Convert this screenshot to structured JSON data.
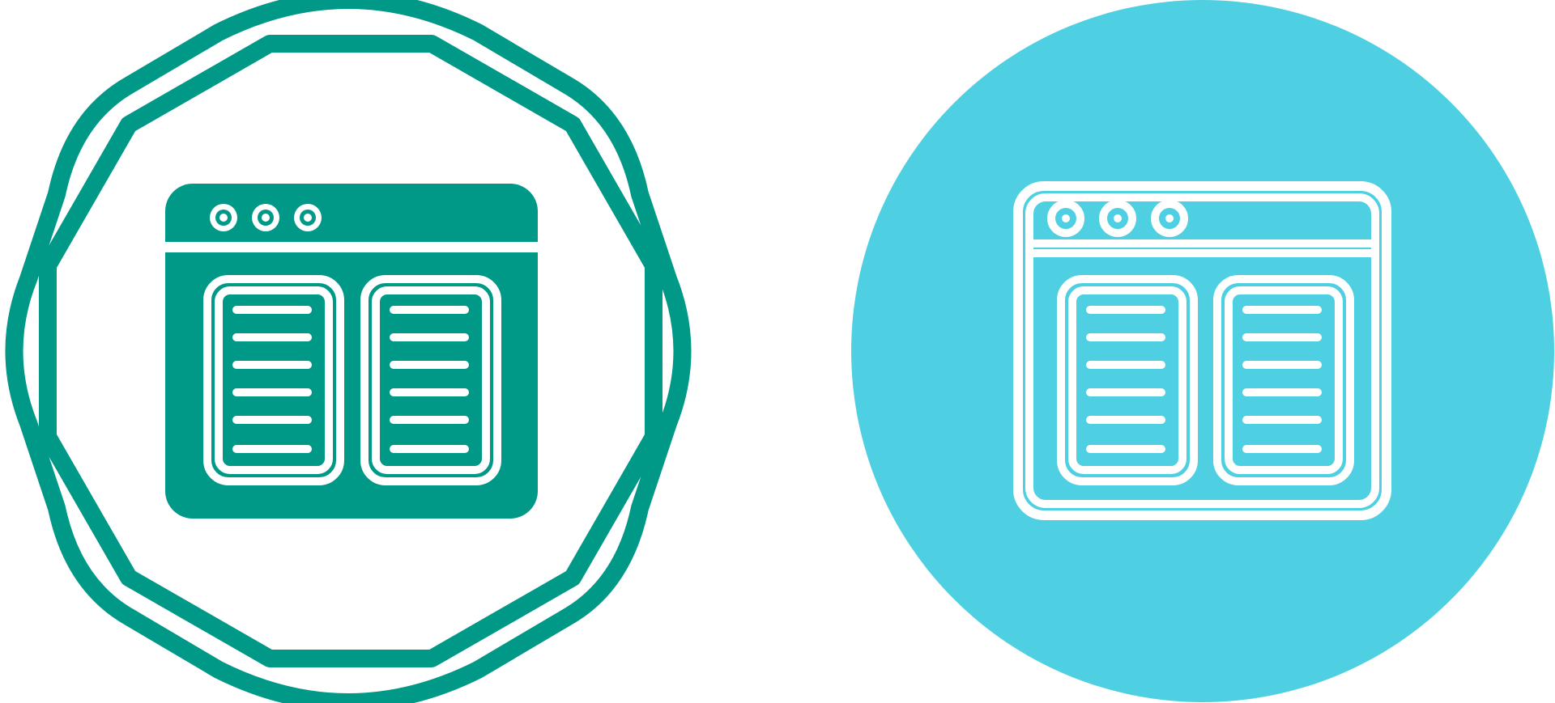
{
  "icons": [
    {
      "name": "browser-columns-badge-icon",
      "style": "glyph",
      "primary_color": "#009887",
      "background_color": "#ffffff"
    },
    {
      "name": "browser-columns-circle-icon",
      "style": "line",
      "primary_color": "#ffffff",
      "background_color": "#4fd0e2"
    }
  ],
  "colors": {
    "teal": "#009887",
    "cyan": "#4fd0e2",
    "white": "#ffffff"
  }
}
